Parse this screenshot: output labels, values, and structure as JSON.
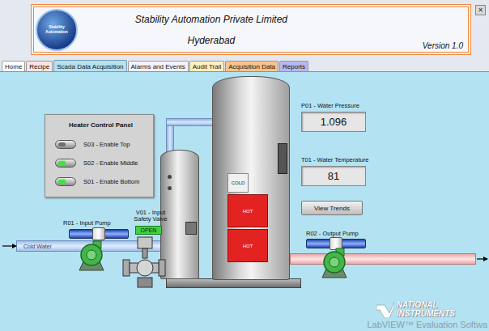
{
  "header": {
    "logo_text": "Stability Automation",
    "company": "Stability Automation Private Limited",
    "city": "Hyderabad",
    "version": "Version 1.0"
  },
  "close": "✕",
  "tabs": [
    {
      "label": "Home",
      "selected": false,
      "color": "#ffffff"
    },
    {
      "label": "Recipe",
      "selected": false,
      "color": "#fbe3e3"
    },
    {
      "label": "Scada Data Acquisition",
      "selected": true,
      "color": "#b3e2f2"
    },
    {
      "label": "Alarms and Events",
      "selected": false,
      "color": "#f2f2fa"
    },
    {
      "label": "Audit Trail",
      "selected": false,
      "color": "#fff0c2"
    },
    {
      "label": "Acquisition Data",
      "selected": false,
      "color": "#f7c38c"
    },
    {
      "label": "Reports",
      "selected": false,
      "color": "#b8b8f0"
    }
  ],
  "heater_panel": {
    "title": "Heater Control Panel",
    "switches": [
      {
        "label": "S03 - Enable Top",
        "on": false
      },
      {
        "label": "S02 - Enable Middle",
        "on": true
      },
      {
        "label": "S01 - Enable Bottom",
        "on": true
      }
    ]
  },
  "tank_zones": [
    {
      "label": "COLD",
      "hot": false
    },
    {
      "label": "HOT",
      "hot": true
    },
    {
      "label": "HOT",
      "hot": true
    }
  ],
  "input_pump": {
    "label": "R01 - Input Pump"
  },
  "output_pump": {
    "label": "R02 - Output Pump"
  },
  "valve": {
    "label": "V01 - Input Safety Valve",
    "status": "OPEN"
  },
  "pipe_label": "Cold Water",
  "indicators": [
    {
      "label": "P01 - Water Pressure",
      "value": "1.096"
    },
    {
      "label": "T01 - Water Temperature",
      "value": "81"
    }
  ],
  "trend_button": "View Trends",
  "watermark": {
    "brand_lines": [
      "NATIONAL",
      "INSTRUMENTS"
    ],
    "product": "LabVIEW™ Evaluation Softwa"
  }
}
